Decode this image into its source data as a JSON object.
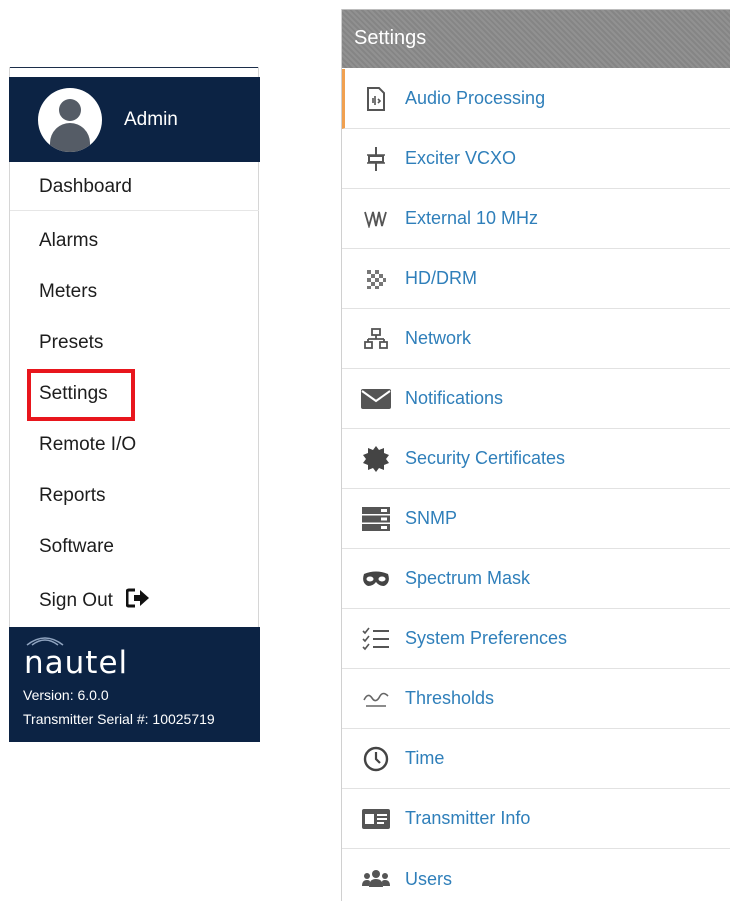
{
  "sidebar": {
    "user": {
      "name": "Admin"
    },
    "nav": {
      "dashboard": "Dashboard",
      "alarms": "Alarms",
      "meters": "Meters",
      "presets": "Presets",
      "settings": "Settings",
      "remote_io": "Remote I/O",
      "reports": "Reports",
      "software": "Software",
      "sign_out": "Sign Out"
    },
    "footer": {
      "brand": "nautel",
      "version": "Version: 6.0.0",
      "serial": "Transmitter Serial #: 10025719"
    }
  },
  "panel": {
    "title": "Settings",
    "items": [
      {
        "label": "Audio Processing",
        "icon": "audio-file-icon",
        "active": true
      },
      {
        "label": "Exciter VCXO",
        "icon": "crystal-oscillator-icon"
      },
      {
        "label": "External 10 MHz",
        "icon": "waveform-icon"
      },
      {
        "label": "HD/DRM",
        "icon": "digital-pattern-icon"
      },
      {
        "label": "Network",
        "icon": "network-icon"
      },
      {
        "label": "Notifications",
        "icon": "envelope-icon"
      },
      {
        "label": "Security Certificates",
        "icon": "certificate-seal-icon"
      },
      {
        "label": "SNMP",
        "icon": "server-stack-icon"
      },
      {
        "label": "Spectrum Mask",
        "icon": "mask-icon"
      },
      {
        "label": "System Preferences",
        "icon": "checklist-icon"
      },
      {
        "label": "Thresholds",
        "icon": "threshold-wave-icon"
      },
      {
        "label": "Time",
        "icon": "clock-icon"
      },
      {
        "label": "Transmitter Info",
        "icon": "id-card-icon"
      },
      {
        "label": "Users",
        "icon": "users-icon"
      }
    ]
  },
  "colors": {
    "sidebar_bg": "#0c2344",
    "link": "#2f7fba",
    "highlight_box": "#e8161d",
    "active_accent": "#f0a050"
  }
}
